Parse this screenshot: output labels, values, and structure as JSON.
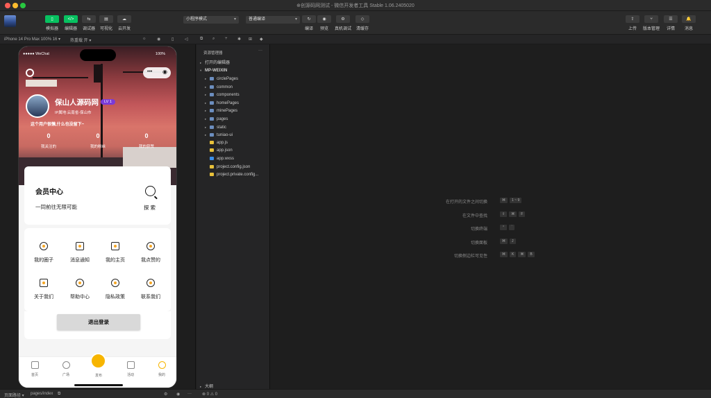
{
  "window": {
    "title": "⊕创源码网测试 - 微信开发者工具 Stable 1.06.2405020"
  },
  "toolbar": {
    "left_buttons": [
      {
        "label": "模拟器",
        "glyph": "▯"
      },
      {
        "label": "编辑器",
        "glyph": "</>"
      },
      {
        "label": "调试器",
        "glyph": "⇆"
      },
      {
        "label": "可视化",
        "glyph": "▤"
      },
      {
        "label": "云开发",
        "glyph": "☁"
      }
    ],
    "mode_select": "小程序模式",
    "compile_select": "普通编译",
    "center_buttons": [
      {
        "label": "编译",
        "glyph": "↻"
      },
      {
        "label": "预览",
        "glyph": "◉"
      },
      {
        "label": "真机调试",
        "glyph": "⚙"
      },
      {
        "label": "清缓存",
        "glyph": "◇"
      }
    ],
    "right_buttons": [
      {
        "label": "上传",
        "glyph": "⇪"
      },
      {
        "label": "版本管理",
        "glyph": "⑂"
      },
      {
        "label": "详情",
        "glyph": "☰"
      },
      {
        "label": "消息",
        "glyph": "🔔"
      }
    ]
  },
  "subbar": {
    "device": "iPhone 14 Pro Max 100% 16 ▾",
    "hotreload": "热重载 开 ▾"
  },
  "phone": {
    "carrier": "●●●●● WeChat",
    "battery": "100%",
    "username": "保山人源码网",
    "level": "LV 1",
    "ip_location": "IP属地:云南省-保山市",
    "motto": "这个用户很懒,什么也没留下~",
    "stats": [
      {
        "num": "0",
        "cap": "我关注的"
      },
      {
        "num": "0",
        "cap": "我的粉丝"
      },
      {
        "num": "0",
        "cap": "我的获赞"
      }
    ],
    "vip_title": "会员中心",
    "vip_sub": "一同前往无限可能",
    "search_label": "探索",
    "grid": [
      {
        "label": "我的圈子",
        "icon": "circle-icon"
      },
      {
        "label": "消息通知",
        "icon": "speaker-icon"
      },
      {
        "label": "我的主页",
        "icon": "home-page-icon"
      },
      {
        "label": "我点赞的",
        "icon": "heart-icon"
      },
      {
        "label": "关于我们",
        "icon": "monitor-icon"
      },
      {
        "label": "帮助中心",
        "icon": "help-icon"
      },
      {
        "label": "隐私政策",
        "icon": "privacy-icon"
      },
      {
        "label": "联系我们",
        "icon": "contact-icon"
      }
    ],
    "logout": "退出登录",
    "tabs": [
      {
        "label": "首页"
      },
      {
        "label": "广场"
      },
      {
        "label": "发布"
      },
      {
        "label": "活动"
      },
      {
        "label": "我的"
      }
    ]
  },
  "explorer": {
    "header": "资源管理器",
    "open_editors": "打开的编辑器",
    "project": "MP-WEIXIN",
    "items": [
      {
        "name": "circlePages",
        "type": "folder"
      },
      {
        "name": "common",
        "type": "folder"
      },
      {
        "name": "components",
        "type": "folder"
      },
      {
        "name": "homePages",
        "type": "folder"
      },
      {
        "name": "minePages",
        "type": "folder"
      },
      {
        "name": "pages",
        "type": "folder"
      },
      {
        "name": "static",
        "type": "folder"
      },
      {
        "name": "tuniao-ui",
        "type": "folder"
      },
      {
        "name": "app.js",
        "type": "js"
      },
      {
        "name": "app.json",
        "type": "json"
      },
      {
        "name": "app.wxss",
        "type": "wxss"
      },
      {
        "name": "project.config.json",
        "type": "json"
      },
      {
        "name": "project.private.config...",
        "type": "json"
      }
    ],
    "outline": "大纲"
  },
  "shortcuts": [
    {
      "label": "在打开的文件之间切换",
      "keys": [
        "⌘",
        "1 ~ 9"
      ]
    },
    {
      "label": "在文件中查找",
      "keys": [
        "⇧",
        "⌘",
        "F"
      ]
    },
    {
      "label": "切换终端",
      "keys": [
        "⌃",
        "`"
      ]
    },
    {
      "label": "切换面板",
      "keys": [
        "⌘",
        "J"
      ]
    },
    {
      "label": "切换侧边栏可见性",
      "keys": [
        "⌘",
        "K",
        "⌘",
        "B"
      ]
    }
  ],
  "statusbar": {
    "page_path_label": "页面路径 ▾",
    "page_path": "pages/index",
    "problems": "⊗ 0 ⚠ 0"
  },
  "colors": {
    "accent_green": "#07c160",
    "level_badge": "#7a3ad8",
    "tab_center": "#f7b500",
    "folder": "#6c8ebf"
  }
}
